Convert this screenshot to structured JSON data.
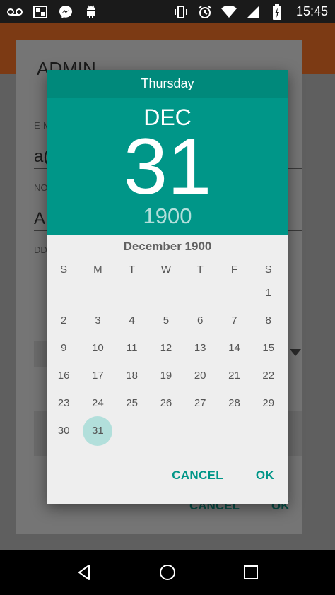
{
  "status_bar": {
    "time": "15:45",
    "left_icons": [
      "voicemail-icon",
      "gallery-icon",
      "messenger-icon",
      "android-icon"
    ],
    "right_icons": [
      "vibrate-icon",
      "alarm-icon",
      "wifi-icon",
      "signal-icon",
      "battery-charging-icon"
    ]
  },
  "background_form": {
    "title": "ADMIN",
    "fields": [
      {
        "label": "E-M",
        "value": "a("
      },
      {
        "label": "NO",
        "value": "AI"
      },
      {
        "label": "DD",
        "value": ""
      }
    ],
    "buttons": {
      "cancel": "CANCEL",
      "ok": "OK"
    }
  },
  "date_picker": {
    "day_of_week": "Thursday",
    "month": "DEC",
    "day": "31",
    "year": "1900",
    "calendar_title": "December 1900",
    "weekday_headers": [
      "S",
      "M",
      "T",
      "W",
      "T",
      "F",
      "S"
    ],
    "weeks": [
      [
        "",
        "",
        "",
        "",
        "",
        "",
        "1"
      ],
      [
        "2",
        "3",
        "4",
        "5",
        "6",
        "7",
        "8"
      ],
      [
        "9",
        "10",
        "11",
        "12",
        "13",
        "14",
        "15"
      ],
      [
        "16",
        "17",
        "18",
        "19",
        "20",
        "21",
        "22"
      ],
      [
        "23",
        "24",
        "25",
        "26",
        "27",
        "28",
        "29"
      ],
      [
        "30",
        "31",
        "",
        "",
        "",
        "",
        ""
      ]
    ],
    "selected_day": "31",
    "buttons": {
      "cancel": "CANCEL",
      "ok": "OK"
    },
    "accent_color": "#009688",
    "header_dark_color": "#00897b"
  },
  "nav_bar": {
    "buttons": [
      "back-icon",
      "home-icon",
      "recents-icon"
    ]
  }
}
